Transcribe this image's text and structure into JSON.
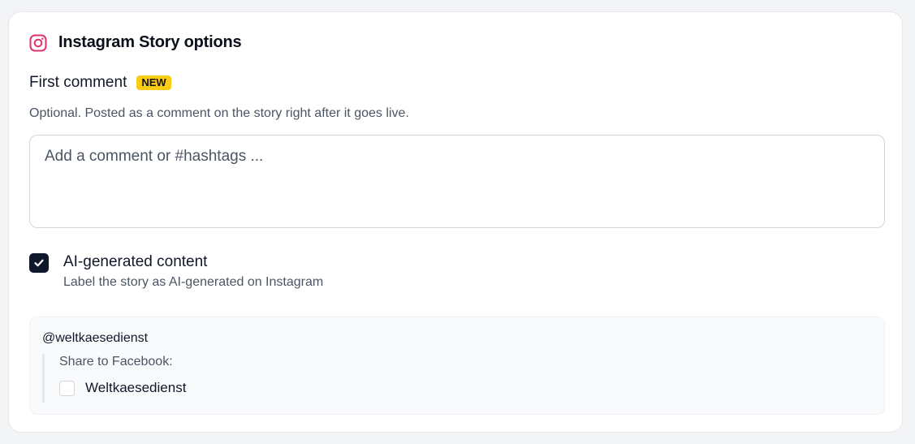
{
  "section": {
    "title": "Instagram Story options",
    "icon": "instagram-icon",
    "icon_color": "#e1306c"
  },
  "first_comment": {
    "label": "First comment",
    "badge": "NEW",
    "badge_color": "#facc15",
    "help": "Optional. Posted as a comment on the story right after it goes live.",
    "placeholder": "Add a comment or #hashtags ...",
    "value": ""
  },
  "ai_generated": {
    "checked": true,
    "title": "AI-generated content",
    "description": "Label the story as AI-generated on Instagram",
    "check_icon": "checkmark-icon"
  },
  "account": {
    "handle": "@weltkaesedienst",
    "share_label": "Share to Facebook:",
    "facebook_pages": [
      {
        "name": "Weltkaesedienst",
        "checked": false
      }
    ]
  }
}
